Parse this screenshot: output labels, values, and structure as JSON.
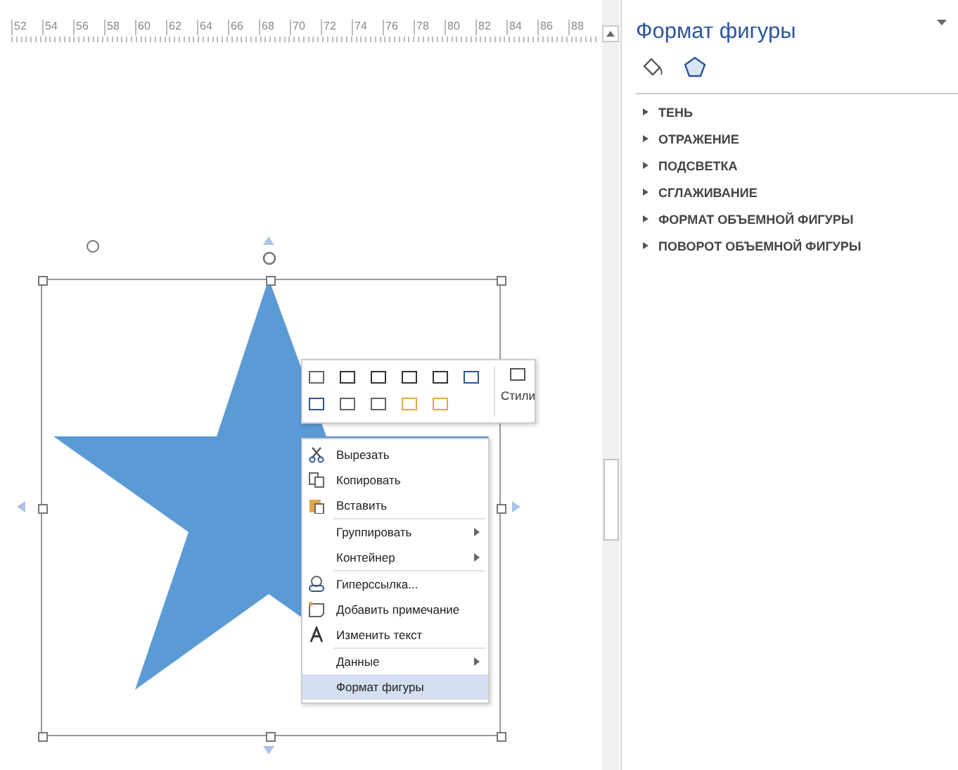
{
  "ruler": {
    "labels": [
      "52",
      "54",
      "56",
      "58",
      "60",
      "62",
      "64",
      "66",
      "68",
      "70",
      "72",
      "74",
      "76",
      "78",
      "80",
      "82",
      "84",
      "86",
      "88"
    ]
  },
  "mini_toolbar": {
    "styles_label": "Стили"
  },
  "context_menu": {
    "items": [
      {
        "label": "Вырезать",
        "submenu": false,
        "selected": false
      },
      {
        "label": "Копировать",
        "submenu": false,
        "selected": false
      },
      {
        "label": "Вставить",
        "submenu": false,
        "selected": false
      },
      {
        "label": "Группировать",
        "submenu": true,
        "selected": false
      },
      {
        "label": "Контейнер",
        "submenu": true,
        "selected": false
      },
      {
        "label": "Гиперссылка...",
        "submenu": false,
        "selected": false
      },
      {
        "label": "Добавить примечание",
        "submenu": false,
        "selected": false
      },
      {
        "label": "Изменить текст",
        "submenu": false,
        "selected": false
      },
      {
        "label": "Данные",
        "submenu": true,
        "selected": false
      },
      {
        "label": "Формат фигуры",
        "submenu": false,
        "selected": true
      }
    ]
  },
  "format_pane": {
    "title": "Формат фигуры",
    "tabs": [
      {
        "selected": false
      },
      {
        "selected": true
      }
    ],
    "sections": [
      {
        "label": "ТЕНЬ",
        "expanded": false
      },
      {
        "label": "ОТРАЖЕНИЕ",
        "expanded": false
      },
      {
        "label": "ПОДСВЕТКА",
        "expanded": false
      },
      {
        "label": "СГЛАЖИВАНИЕ",
        "expanded": false
      },
      {
        "label": "ФОРМАТ ОБЪЕМНОЙ ФИГУРЫ",
        "expanded": false
      },
      {
        "label": "ПОВОРОТ ОБЪЕМНОЙ ФИГУРЫ",
        "expanded": false
      }
    ]
  }
}
